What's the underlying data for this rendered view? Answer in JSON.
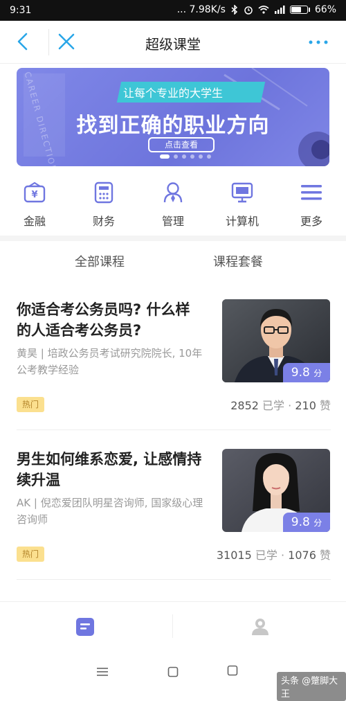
{
  "status_bar": {
    "time": "9:31",
    "network_speed": "... 7.98K/s",
    "battery": "66%",
    "battery_level": 0.66
  },
  "nav": {
    "title": "超级课堂"
  },
  "banner": {
    "subtitle": "让每个专业的大学生",
    "headline": "找到正确的职业方向",
    "button": "点击查看",
    "side_text": "CAREER DIRECTION",
    "page_count": 6,
    "active_page": 1
  },
  "categories": [
    {
      "label": "金融",
      "icon": "finance-icon"
    },
    {
      "label": "财务",
      "icon": "calculator-icon"
    },
    {
      "label": "管理",
      "icon": "manager-icon"
    },
    {
      "label": "计算机",
      "icon": "computer-icon"
    },
    {
      "label": "更多",
      "icon": "more-list-icon"
    }
  ],
  "tabs": [
    {
      "label": "全部课程"
    },
    {
      "label": "课程套餐"
    }
  ],
  "courses": [
    {
      "title": "你适合考公务员吗? 什么样的人适合考公务员?",
      "meta": "黄昊 | 培政公务员考试研究院院长, 10年公考教学经验",
      "tag": "热门",
      "score": "9.8",
      "score_unit": "分",
      "learners": "2852",
      "learners_label": "已学",
      "likes": "210",
      "likes_label": "赞"
    },
    {
      "title": "男生如何维系恋爱, 让感情持续升温",
      "meta": "AK | 倪恋爱团队明星咨询师, 国家级心理咨询师",
      "tag": "热门",
      "score": "9.8",
      "score_unit": "分",
      "learners": "31015",
      "learners_label": "已学",
      "likes": "1076",
      "likes_label": "赞"
    }
  ],
  "watermark": "头条 @蹩脚大王",
  "colors": {
    "accent": "#2aa6e8",
    "primary_purple": "#6f76e0",
    "tag_bg": "#fbe08f"
  }
}
